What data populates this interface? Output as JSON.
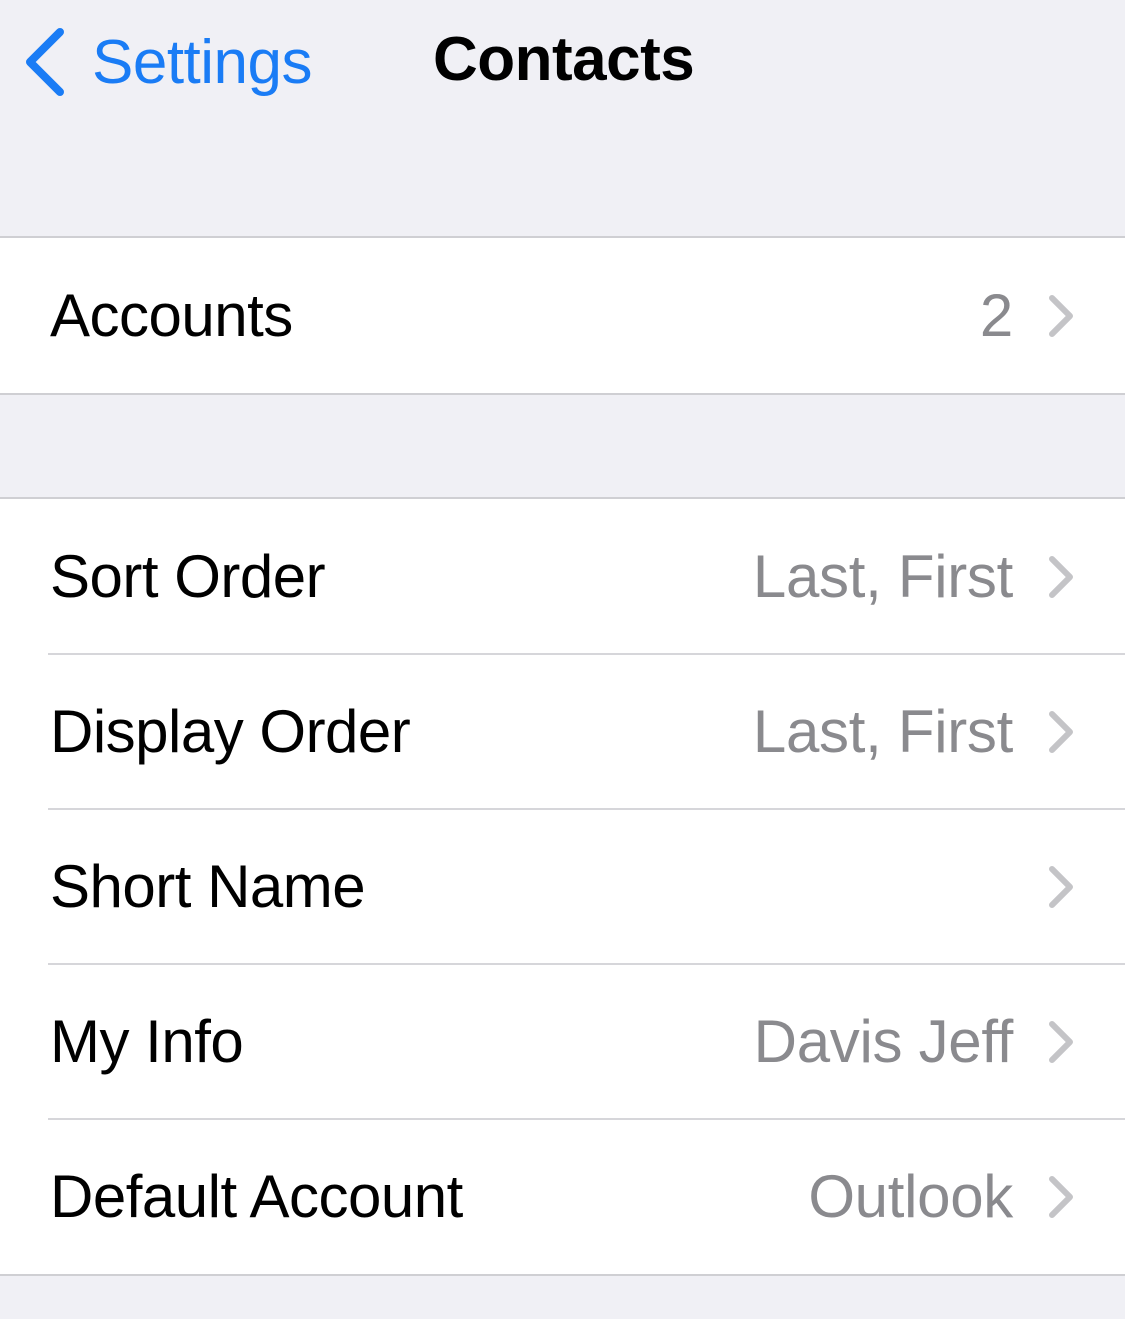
{
  "colors": {
    "accent": "#1a7cf5",
    "background": "#f0f0f5",
    "cell_background": "#ffffff",
    "secondary_text": "#8a8a8e",
    "chevron": "#c4c4c7",
    "separator": "#d6d6da"
  },
  "navbar": {
    "back_label": "Settings",
    "back_icon": "chevron-left-icon",
    "title": "Contacts"
  },
  "groups": [
    {
      "rows": [
        {
          "label": "Accounts",
          "value": "2",
          "icon": "chevron-right-icon"
        }
      ]
    },
    {
      "rows": [
        {
          "label": "Sort Order",
          "value": "Last, First",
          "icon": "chevron-right-icon"
        },
        {
          "label": "Display Order",
          "value": "Last, First",
          "icon": "chevron-right-icon"
        },
        {
          "label": "Short Name",
          "value": "",
          "icon": "chevron-right-icon"
        },
        {
          "label": "My Info",
          "value": "Davis Jeff",
          "icon": "chevron-right-icon"
        },
        {
          "label": "Default Account",
          "value": "Outlook",
          "icon": "chevron-right-icon"
        }
      ]
    }
  ]
}
